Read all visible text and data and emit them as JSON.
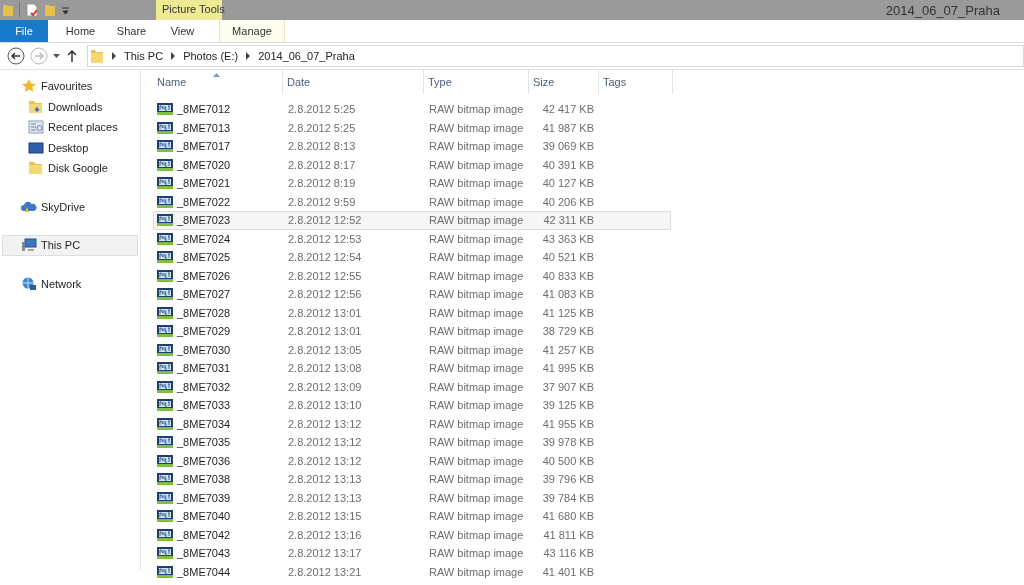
{
  "window": {
    "title": "2014_06_07_Praha"
  },
  "contextual_tab_group": "Picture Tools",
  "ribbon_tabs": [
    {
      "label": "File",
      "kind": "file",
      "selected": false
    },
    {
      "label": "Home",
      "kind": "tab",
      "selected": false
    },
    {
      "label": "Share",
      "kind": "tab",
      "selected": false
    },
    {
      "label": "View",
      "kind": "tab",
      "selected": false
    },
    {
      "label": "Manage",
      "kind": "context",
      "selected": false
    }
  ],
  "address": {
    "breadcrumbs": [
      "This PC",
      "Photos (E:)",
      "2014_06_07_Praha"
    ]
  },
  "navigation": [
    {
      "label": "Favourites",
      "kind": "star",
      "selected": false,
      "children": [
        {
          "label": "Downloads",
          "kind": "downloads",
          "selected": false
        },
        {
          "label": "Recent places",
          "kind": "recent",
          "selected": false
        },
        {
          "label": "Desktop",
          "kind": "desktop",
          "selected": false
        },
        {
          "label": "Disk Google",
          "kind": "folder",
          "selected": false
        }
      ]
    },
    {
      "label": "SkyDrive",
      "kind": "cloud",
      "selected": false
    },
    {
      "label": "This PC",
      "kind": "pc",
      "selected": true
    },
    {
      "label": "Network",
      "kind": "network",
      "selected": false
    }
  ],
  "table": {
    "columns": [
      "Name",
      "Date",
      "Type",
      "Size",
      "Tags"
    ],
    "rows": [
      {
        "name": "_8ME7012",
        "date": "2.8.2012 5:25",
        "type": "RAW bitmap image",
        "size": "42 417 KB",
        "selected": false
      },
      {
        "name": "_8ME7013",
        "date": "2.8.2012 5:25",
        "type": "RAW bitmap image",
        "size": "41 987 KB",
        "selected": false
      },
      {
        "name": "_8ME7017",
        "date": "2.8.2012 8:13",
        "type": "RAW bitmap image",
        "size": "39 069 KB",
        "selected": false
      },
      {
        "name": "_8ME7020",
        "date": "2.8.2012 8:17",
        "type": "RAW bitmap image",
        "size": "40 391 KB",
        "selected": false
      },
      {
        "name": "_8ME7021",
        "date": "2.8.2012 8:19",
        "type": "RAW bitmap image",
        "size": "40 127 KB",
        "selected": false
      },
      {
        "name": "_8ME7022",
        "date": "2.8.2012 9:59",
        "type": "RAW bitmap image",
        "size": "40 206 KB",
        "selected": false
      },
      {
        "name": "_8ME7023",
        "date": "2.8.2012 12:52",
        "type": "RAW bitmap image",
        "size": "42 311 KB",
        "selected": true
      },
      {
        "name": "_8ME7024",
        "date": "2.8.2012 12:53",
        "type": "RAW bitmap image",
        "size": "43 363 KB",
        "selected": false
      },
      {
        "name": "_8ME7025",
        "date": "2.8.2012 12:54",
        "type": "RAW bitmap image",
        "size": "40 521 KB",
        "selected": false
      },
      {
        "name": "_8ME7026",
        "date": "2.8.2012 12:55",
        "type": "RAW bitmap image",
        "size": "40 833 KB",
        "selected": false
      },
      {
        "name": "_8ME7027",
        "date": "2.8.2012 12:56",
        "type": "RAW bitmap image",
        "size": "41 083 KB",
        "selected": false
      },
      {
        "name": "_8ME7028",
        "date": "2.8.2012 13:01",
        "type": "RAW bitmap image",
        "size": "41 125 KB",
        "selected": false
      },
      {
        "name": "_8ME7029",
        "date": "2.8.2012 13:01",
        "type": "RAW bitmap image",
        "size": "38 729 KB",
        "selected": false
      },
      {
        "name": "_8ME7030",
        "date": "2.8.2012 13:05",
        "type": "RAW bitmap image",
        "size": "41 257 KB",
        "selected": false
      },
      {
        "name": "_8ME7031",
        "date": "2.8.2012 13:08",
        "type": "RAW bitmap image",
        "size": "41 995 KB",
        "selected": false
      },
      {
        "name": "_8ME7032",
        "date": "2.8.2012 13:09",
        "type": "RAW bitmap image",
        "size": "37 907 KB",
        "selected": false
      },
      {
        "name": "_8ME7033",
        "date": "2.8.2012 13:10",
        "type": "RAW bitmap image",
        "size": "39 125 KB",
        "selected": false
      },
      {
        "name": "_8ME7034",
        "date": "2.8.2012 13:12",
        "type": "RAW bitmap image",
        "size": "41 955 KB",
        "selected": false
      },
      {
        "name": "_8ME7035",
        "date": "2.8.2012 13:12",
        "type": "RAW bitmap image",
        "size": "39 978 KB",
        "selected": false
      },
      {
        "name": "_8ME7036",
        "date": "2.8.2012 13:12",
        "type": "RAW bitmap image",
        "size": "40 500 KB",
        "selected": false
      },
      {
        "name": "_8ME7038",
        "date": "2.8.2012 13:13",
        "type": "RAW bitmap image",
        "size": "39 796 KB",
        "selected": false
      },
      {
        "name": "_8ME7039",
        "date": "2.8.2012 13:13",
        "type": "RAW bitmap image",
        "size": "39 784 KB",
        "selected": false
      },
      {
        "name": "_8ME7040",
        "date": "2.8.2012 13:15",
        "type": "RAW bitmap image",
        "size": "41 680 KB",
        "selected": false
      },
      {
        "name": "_8ME7042",
        "date": "2.8.2012 13:16",
        "type": "RAW bitmap image",
        "size": "41 811 KB",
        "selected": false
      },
      {
        "name": "_8ME7043",
        "date": "2.8.2012 13:17",
        "type": "RAW bitmap image",
        "size": "43 116 KB",
        "selected": false
      },
      {
        "name": "_8ME7044",
        "date": "2.8.2012 13:21",
        "type": "RAW bitmap image",
        "size": "41 401 KB",
        "selected": false
      }
    ]
  }
}
